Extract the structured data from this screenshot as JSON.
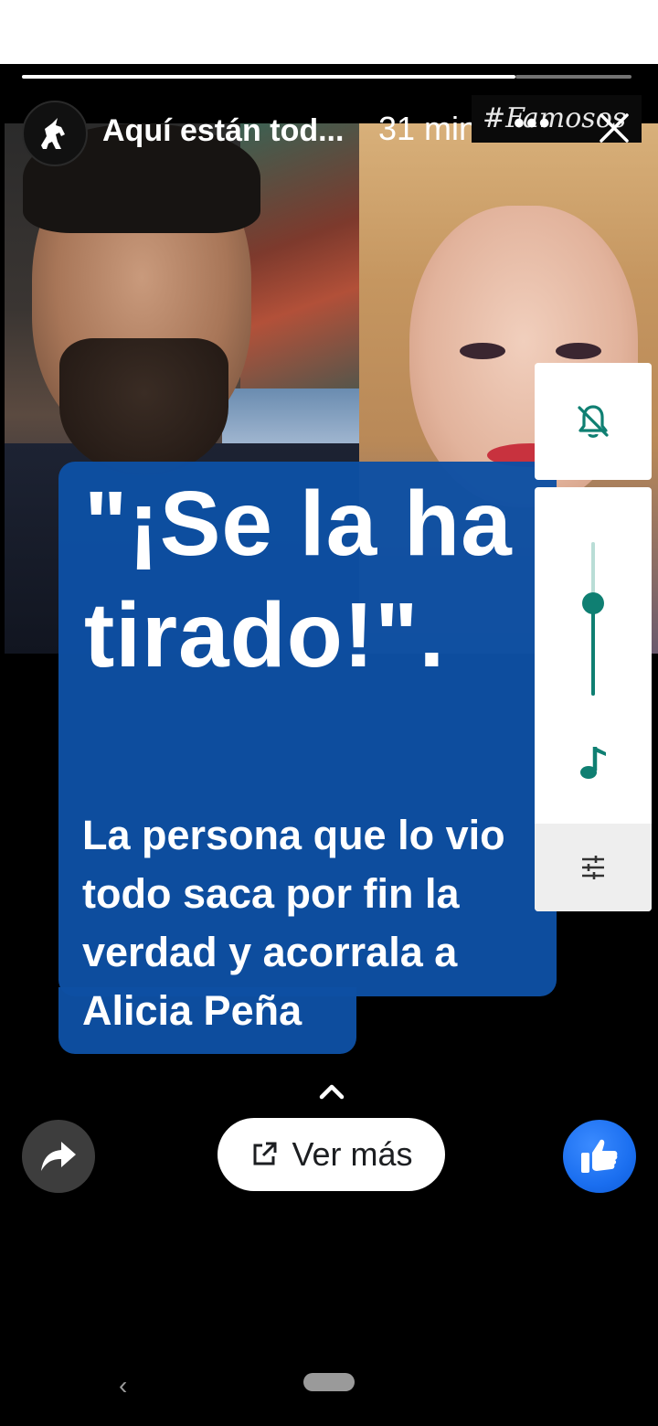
{
  "story": {
    "title": "Aquí están tod...",
    "time": "31 min",
    "hashtag": "#Famosos",
    "more_glyph": "•••",
    "headline": "\"¡Se la ha\ntirado!\".",
    "subtext": "La persona que lo vio\ntodo saca por fin la\nverdad y acorrala a\nAlicia Peña",
    "progress": 0.81
  },
  "side_panel": {
    "notification_state": "muted",
    "volume_level": 0.6,
    "icons": [
      "bell-off-icon",
      "music-note-icon",
      "sliders-icon"
    ]
  },
  "actions": {
    "ver_mas_label": "Ver más"
  },
  "nav": {
    "back_glyph": "‹"
  },
  "colors": {
    "caption_blue": "#0d4fa3",
    "accent_teal": "#0f7f72",
    "like_blue": "#1b6ff0"
  }
}
